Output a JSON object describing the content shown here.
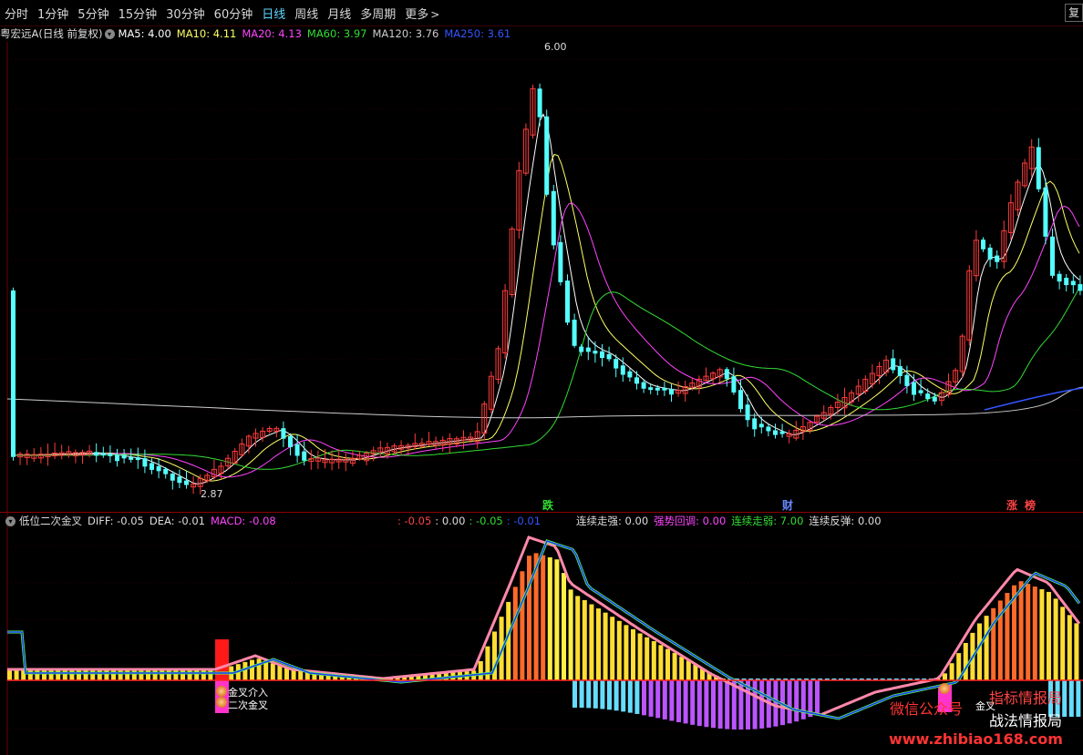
{
  "toolbar": {
    "tabs": [
      "分时",
      "1分钟",
      "5分钟",
      "15分钟",
      "30分钟",
      "60分钟",
      "日线",
      "周线",
      "月线",
      "多周期",
      "更多"
    ],
    "active_index": 6,
    "more_chevron": ">",
    "corner_label": "复"
  },
  "main_legend": {
    "stock": "粤宏远A",
    "mode": "(日线 前复权)",
    "items": [
      {
        "label": "MA5: 4.00",
        "color": "#ffffff"
      },
      {
        "label": "MA10: 4.11",
        "color": "#ffff66"
      },
      {
        "label": "MA20: 4.13",
        "color": "#ff44ff"
      },
      {
        "label": "MA60: 3.97",
        "color": "#33dd33"
      },
      {
        "label": "MA120: 3.76",
        "color": "#cccccc"
      },
      {
        "label": "MA250: 3.61",
        "color": "#3355ff"
      }
    ]
  },
  "price_labels": {
    "high": "6.00",
    "low": "2.87"
  },
  "events": [
    {
      "text": "跌",
      "color": "#33dd33"
    },
    {
      "text": "财",
      "color": "#6688ff"
    },
    {
      "text": "涨",
      "color": "#ff4444"
    },
    {
      "text": "榜",
      "color": "#ff4444"
    }
  ],
  "lower_legend": {
    "name": "低位二次金叉",
    "items": [
      {
        "label": "DIFF: -0.05",
        "color": "#dddddd"
      },
      {
        "label": "DEA: -0.01",
        "color": "#dddddd"
      },
      {
        "label": "MACD: -0.08",
        "color": "#ff44ff"
      }
    ],
    "mid": [
      {
        "label": ": -0.05",
        "color": "#ff4444"
      },
      {
        "label": ": 0.00",
        "color": "#dddddd"
      },
      {
        "label": ": -0.05",
        "color": "#33dd33"
      },
      {
        "label": ": -0.01",
        "color": "#3355ff"
      }
    ],
    "right": [
      {
        "label": "连续走强: 0.00",
        "color": "#dddddd"
      },
      {
        "label": "强势回调: 0.00",
        "color": "#ff44ff"
      },
      {
        "label": "连续走弱: 7.00",
        "color": "#33dd33"
      },
      {
        "label": "连续反弹: 0.00",
        "color": "#dddddd"
      }
    ]
  },
  "signals": {
    "cross1": "金叉介入",
    "cross2": "二次金叉",
    "cross3": "金叉"
  },
  "watermarks": {
    "wechat": "微信公众号",
    "brand1": "指标情报局",
    "brand2": "战法情报局",
    "url": "www.zhibiao168.com"
  }
}
